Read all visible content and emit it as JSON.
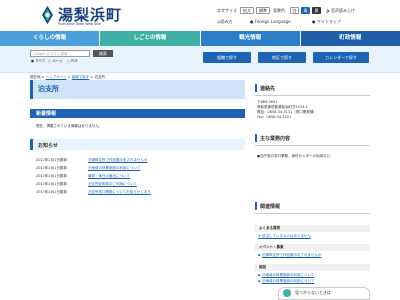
{
  "header": {
    "site_name": "湯梨浜町",
    "site_name_en": "Yurihama Town  Web Site",
    "text_size_label": "文字サイズ",
    "text_size_enlarge": "拡大",
    "text_size_standard": "標準",
    "bg_color_label": "背景色",
    "bg_white": "白",
    "bg_blue": "青",
    "bg_black": "黒",
    "voice_read": "音声読み上げ",
    "reading_label": "読み方",
    "foreign_language": "Foreign Language",
    "sitemap": "サイトマップ"
  },
  "nav": {
    "items": [
      {
        "label": "くらしの情報",
        "color": "#4a9fd8"
      },
      {
        "label": "しごとの情報",
        "color": "#3fb0a6"
      },
      {
        "label": "観光情報",
        "color": "#2a7fc8"
      },
      {
        "label": "町政情報",
        "color": "#1f5ea8"
      }
    ]
  },
  "search": {
    "placeholder": "Google カスタム検索",
    "button": "検索",
    "scope_all": "すべて",
    "scope_page": "ページ",
    "scope_pdf": "PDF"
  },
  "quick": {
    "org": "組織で探す",
    "area": "地区で探す",
    "calendar": "カレンダーで探す"
  },
  "breadcrumb": {
    "home": "現在地",
    "top": "トップページ",
    "org": "組織で探す",
    "current": "泊支所"
  },
  "main": {
    "title": "泊支所",
    "new_info_heading": "新着情報",
    "new_info_text": "現在、掲載されている情報はありません。",
    "notice_heading": "お知らせ",
    "notices": [
      {
        "date": "2017年2月1日更新",
        "title": "泊湖畔支所で作品展示をされませんか"
      },
      {
        "date": "2017年2月1日更新",
        "title": "泊地域の林業施設の利用について"
      },
      {
        "date": "2017年2月1日更新",
        "title": "最寄・休日の届出について"
      },
      {
        "date": "2017年2月1日更新",
        "title": "泊支所証明書のご利用について"
      },
      {
        "date": "2017年2月1日更新",
        "title": "泊支所窓口業務についてお知らせします"
      }
    ]
  },
  "sidebar": {
    "contact_heading": "連絡先",
    "contact_lines": [
      "〒689-0601",
      "鳥取県東伯郡湯梨浜町泊1034-1",
      "電話：0858-34-3111（窓口業務課）",
      "Fax：0858-34-3201"
    ],
    "business_heading": "主な業務内容",
    "business_text": "●泊庁舎の窓口業務、漁村センターの利用など。",
    "related_heading": "関連情報",
    "faq_heading": "よくある質問",
    "faq_links": [
      "※ 該当しているものはありません"
    ],
    "event_heading": "イベント・募集",
    "event_links": [
      "泊湖畔支所で作品展示をされませんか"
    ],
    "facility_heading": "施設",
    "facility_links": [
      "泊地域の林業施設の利用について",
      "泊地域の林業施設の利用について"
    ],
    "bottom_text": "見つからないときは"
  },
  "colors": {
    "accent": "#1e64b4",
    "light_bg": "#e9f3fb"
  }
}
